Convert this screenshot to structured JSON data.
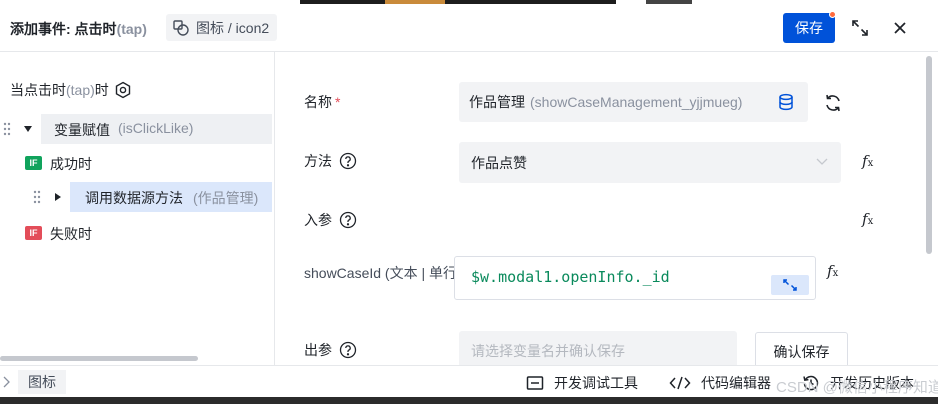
{
  "header": {
    "title_main": "添加事件: 点击时",
    "title_tap": "(tap)",
    "breadcrumb": "图标 / icon2",
    "save_label": "保存"
  },
  "left": {
    "trigger_main": "当点击时",
    "trigger_tap": "(tap)",
    "trigger_suffix": "时",
    "tree": [
      {
        "label": "变量赋值",
        "sub": "(isClickLike)"
      },
      {
        "badge": "IF",
        "label": "成功时"
      },
      {
        "label": "调用数据源方法",
        "sub": "(作品管理)"
      },
      {
        "badge": "IF",
        "label": "失败时"
      }
    ]
  },
  "form": {
    "name_label": "名称",
    "name_required": "*",
    "name_value": "作品管理",
    "name_sub": "(showCaseManagement_yjjmueg)",
    "method_label": "方法",
    "method_value": "作品点赞",
    "params_label": "入参",
    "param_label": "showCaseId (文本 | 单行",
    "param_value": "$w.modal1.openInfo._id",
    "output_label": "出参",
    "output_placeholder": "请选择变量名并确认保存",
    "confirm_label": "确认保存",
    "fx_text": "f",
    "fx_sub": "x"
  },
  "footer": {
    "tab_label": "图标",
    "tools": [
      "开发调试工具",
      "代码编辑器",
      "开发历史版本"
    ]
  },
  "watermark": "CSDN @微信小程序知道",
  "colors": {
    "primary": "#0052d9",
    "success": "#10a35c",
    "danger": "#e34d59",
    "selected": "#dbe7fb"
  },
  "icons": [
    "component-icon",
    "expand-icon",
    "close-icon",
    "settings-icon",
    "drag-handle-icon",
    "database-icon",
    "refresh-icon",
    "help-icon",
    "fx-icon",
    "chevron-down-icon",
    "collapse-icon",
    "terminal-icon",
    "code-icon",
    "history-icon"
  ]
}
